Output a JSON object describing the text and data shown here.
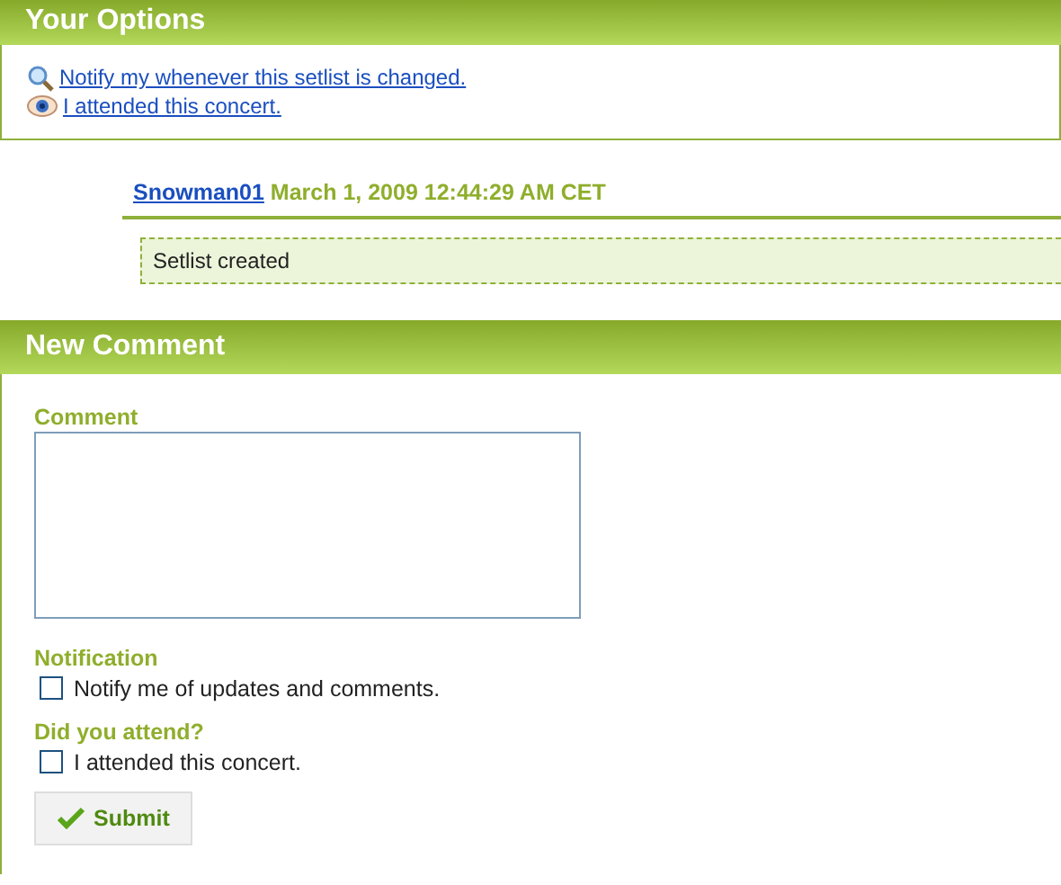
{
  "options_panel": {
    "title": "Your Options",
    "links": [
      {
        "kind": "notify",
        "text": "Notify my whenever this setlist is changed."
      },
      {
        "kind": "attend",
        "text": "I attended this concert."
      }
    ]
  },
  "comments": [
    {
      "user": "Snowman01",
      "date": "March 1, 2009 12:44:29 AM CET",
      "text": "Setlist created"
    }
  ],
  "new_comment": {
    "title": "New Comment",
    "comment_label": "Comment",
    "notification_label": "Notification",
    "notification_checkbox": {
      "label": "Notify me of updates and comments.",
      "checked": false
    },
    "attend_label": "Did you attend?",
    "attend_checkbox": {
      "label": "I attended this concert.",
      "checked": false
    },
    "submit": "Submit"
  }
}
